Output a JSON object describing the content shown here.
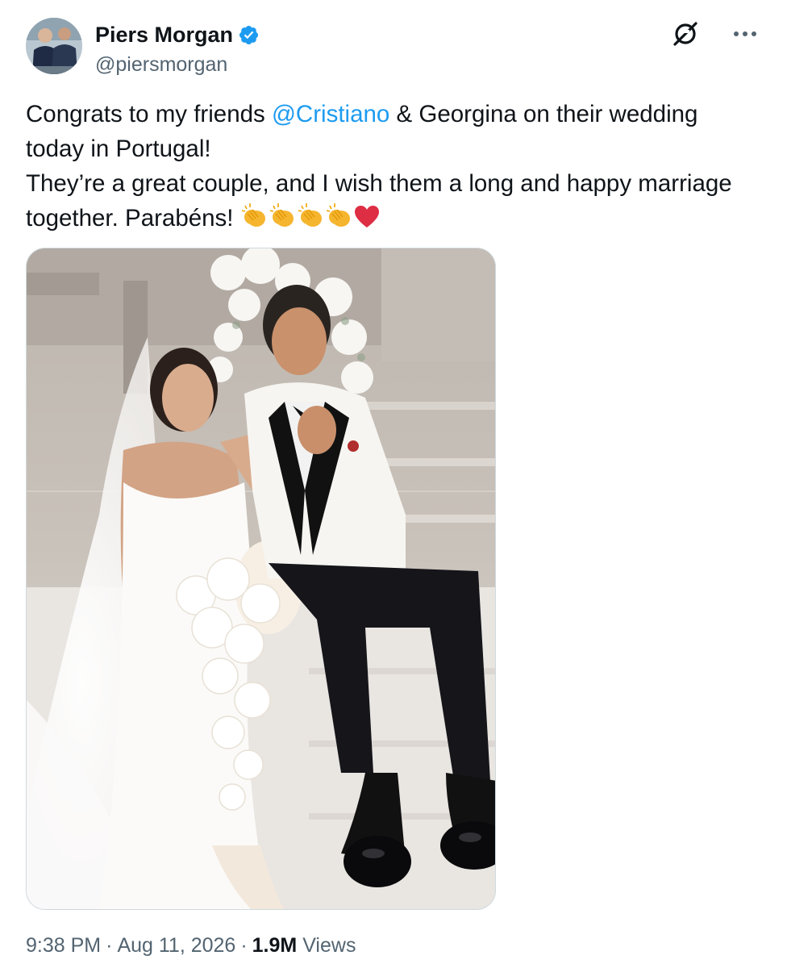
{
  "author": {
    "display_name": "Piers Morgan",
    "handle": "@piersmorgan",
    "verified": true,
    "verified_icon": "verified-badge-icon",
    "accent_color": "#1d9bf0"
  },
  "tweet": {
    "line1_prefix": "Congrats to my friends ",
    "mention": "@Cristiano",
    "line1_suffix": " & Georgina on their wedding today in Portugal!",
    "line2": "They’re a great couple, and I wish them a long and happy marriage together. Parabéns! ",
    "emojis": [
      "clapping-hands",
      "clapping-hands",
      "clapping-hands",
      "clapping-hands",
      "red-heart"
    ]
  },
  "meta": {
    "time": "9:38 PM",
    "date": "Aug 11, 2026",
    "views_count": "1.9M",
    "views_label": "Views"
  },
  "icons": {
    "grok": "grok-icon",
    "more": "more-options-icon"
  }
}
